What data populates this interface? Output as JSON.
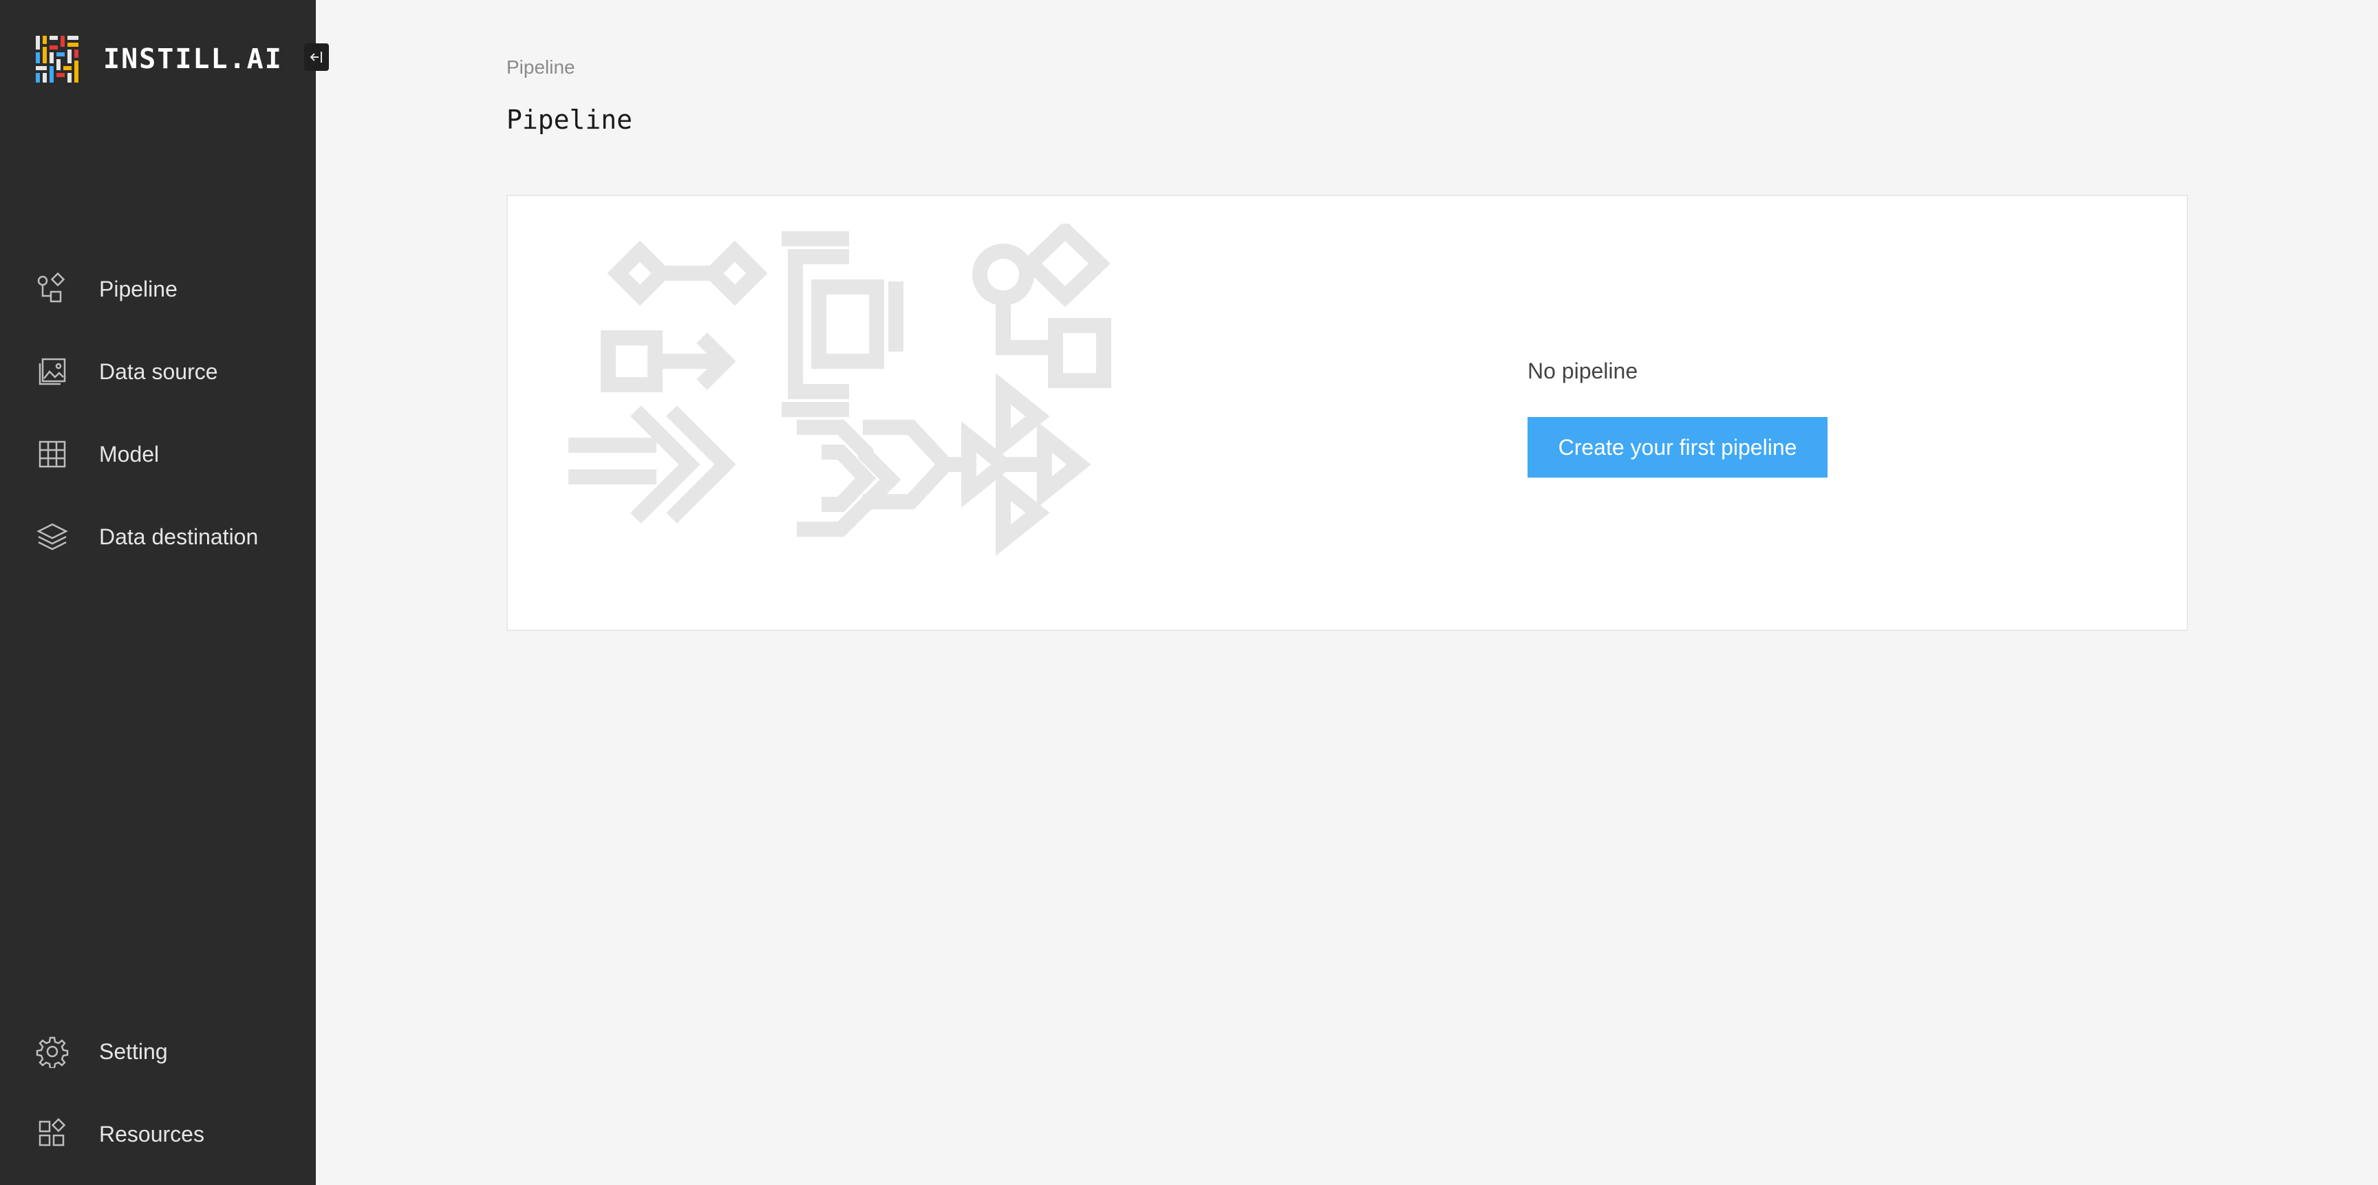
{
  "brand": {
    "name": "INSTILL.AI",
    "logo_colors": [
      "#f4b400",
      "#e53935",
      "#40a8f5",
      "#ffffff"
    ]
  },
  "sidebar": {
    "collapse_icon": "collapse-left-icon",
    "items": [
      {
        "label": "Pipeline",
        "icon": "pipeline-icon"
      },
      {
        "label": "Data source",
        "icon": "data-source-icon"
      },
      {
        "label": "Model",
        "icon": "model-grid-icon"
      },
      {
        "label": "Data destination",
        "icon": "layers-icon"
      }
    ],
    "bottom_items": [
      {
        "label": "Setting",
        "icon": "gear-icon"
      },
      {
        "label": "Resources",
        "icon": "resources-icon"
      }
    ]
  },
  "main": {
    "breadcrumb": "Pipeline",
    "title": "Pipeline",
    "empty_state": {
      "message": "No pipeline",
      "button_label": "Create your first pipeline",
      "button_color": "#40a8f5"
    }
  },
  "colors": {
    "sidebar_bg": "#2b2b2b",
    "page_bg": "#f5f5f5",
    "illustration": "#e6e6e6"
  }
}
